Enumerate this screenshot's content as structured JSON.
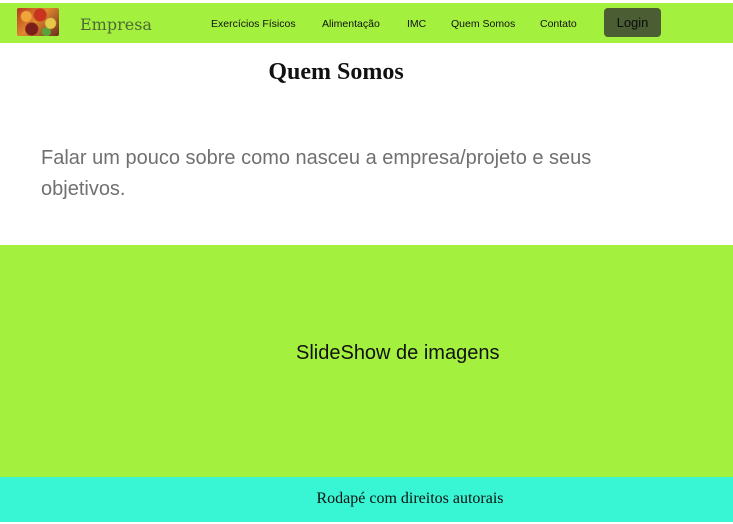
{
  "header": {
    "brand": "Empresa",
    "logo_icon": "fruit-logo-icon",
    "nav": [
      {
        "label": "Exercícios Físicos"
      },
      {
        "label": "Alimentação"
      },
      {
        "label": "IMC"
      },
      {
        "label": "Quem Somos"
      },
      {
        "label": "Contato"
      }
    ],
    "login_label": "Login"
  },
  "about": {
    "title": "Quem Somos",
    "text": "Falar um pouco sobre como nasceu a empresa/projeto e seus objetivos."
  },
  "slideshow": {
    "label": "SlideShow de imagens"
  },
  "footer": {
    "text": "Rodapé com direitos autorais"
  },
  "colors": {
    "nav_background": "#a3f03e",
    "login_button": "#4b5d32",
    "slideshow_background": "#a3f03e",
    "footer_background": "#38f5d4",
    "body_text_muted": "#707070"
  }
}
